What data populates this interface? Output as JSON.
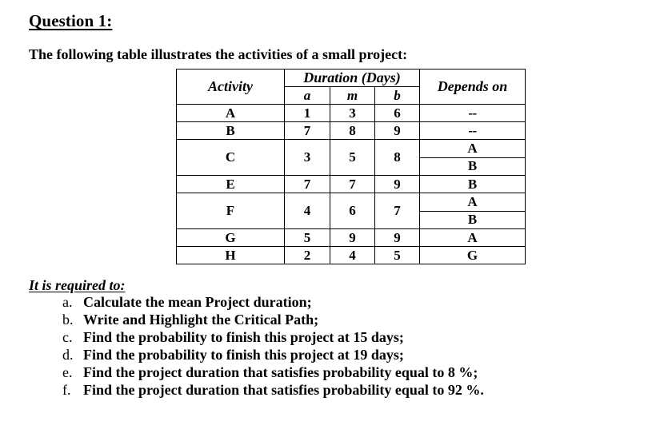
{
  "document": {
    "heading": "Question 1:",
    "intro": "The following table illustrates the activities of a small project:",
    "required_title": "It is required to:"
  },
  "table": {
    "headers": {
      "activity": "Activity",
      "duration_group": "Duration (Days)",
      "sub_a": "a",
      "sub_m": "m",
      "sub_b": "b",
      "depends_on": "Depends on"
    },
    "rows": [
      {
        "activity": "A",
        "a": "1",
        "m": "3",
        "b": "6",
        "depends": "--",
        "split": false
      },
      {
        "activity": "B",
        "a": "7",
        "m": "8",
        "b": "9",
        "depends": "--",
        "split": false
      },
      {
        "activity": "C",
        "a": "3",
        "m": "5",
        "b": "8",
        "depends_top": "A",
        "depends_bottom": "B",
        "split": true
      },
      {
        "activity": "E",
        "a": "7",
        "m": "7",
        "b": "9",
        "depends": "B",
        "split": false
      },
      {
        "activity": "F",
        "a": "4",
        "m": "6",
        "b": "7",
        "depends_top": "A",
        "depends_bottom": "B",
        "split": true
      },
      {
        "activity": "G",
        "a": "5",
        "m": "9",
        "b": "9",
        "depends": "A",
        "split": false
      },
      {
        "activity": "H",
        "a": "2",
        "m": "4",
        "b": "5",
        "depends": "G",
        "split": false
      }
    ]
  },
  "requirements": [
    {
      "marker": "a.",
      "text": "Calculate the mean Project duration;"
    },
    {
      "marker": "b.",
      "text": "Write and Highlight the Critical Path;"
    },
    {
      "marker": "c.",
      "text": "Find the probability to finish this project at 15 days;"
    },
    {
      "marker": "d.",
      "text": "Find the probability to finish this project at 19 days;"
    },
    {
      "marker": "e.",
      "text": "Find the project duration that satisfies probability equal to 8 %;"
    },
    {
      "marker": "f.",
      "text": "Find the project duration that satisfies probability equal to 92 %."
    }
  ],
  "colors": {
    "text": "#000000",
    "background": "#ffffff",
    "border": "#000000"
  }
}
